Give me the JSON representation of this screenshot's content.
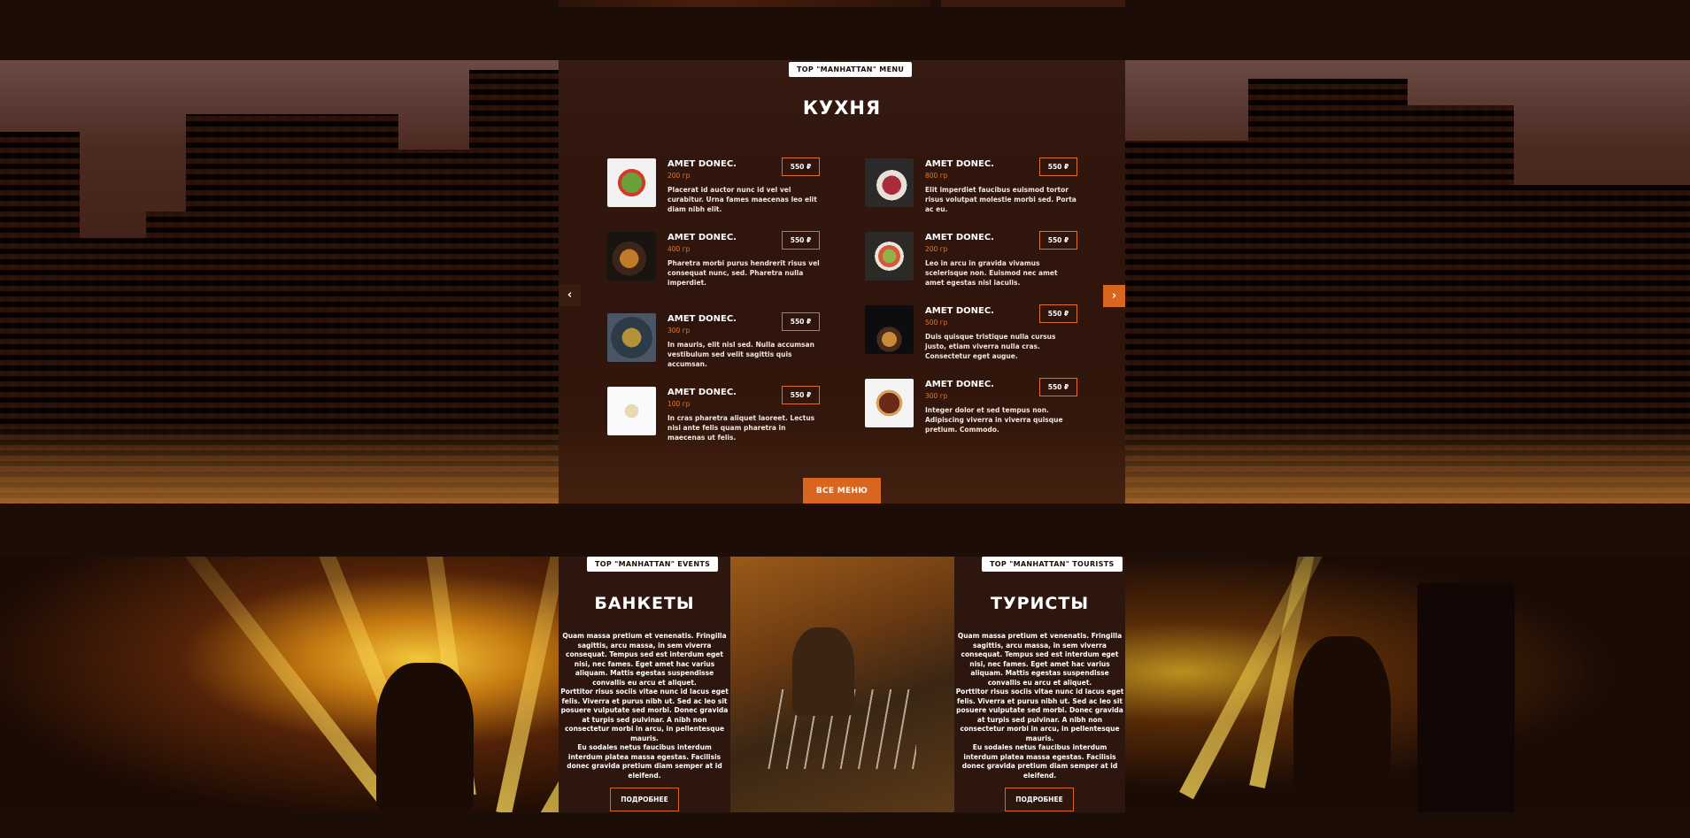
{
  "menu": {
    "tag": "TOP \"MANHATTAN\" MENU",
    "title": "КУХНЯ",
    "items": [
      {
        "name": "AMET DONEC.",
        "weight": "200 гр",
        "price": "550 ₽",
        "desc": "Placerat id auctor nunc id vel vel curabitur. Urna fames maecenas leo elit diam nibh elit."
      },
      {
        "name": "AMET DONEC.",
        "weight": "400 гр",
        "price": "550 ₽",
        "desc": "Pharetra morbi purus hendrerit risus vel consequat nunc, sed. Pharetra nulla imperdiet."
      },
      {
        "name": "AMET DONEC.",
        "weight": "300 гр",
        "price": "550 ₽",
        "desc": "In mauris, elit nisl sed. Nulla accumsan vestibulum sed velit sagittis quis accumsan."
      },
      {
        "name": "AMET DONEC.",
        "weight": "100 гр",
        "price": "550 ₽",
        "desc": "In cras pharetra aliquet laoreet. Lectus nisi ante felis quam pharetra in maecenas ut felis."
      },
      {
        "name": "AMET DONEC.",
        "weight": "800 гр",
        "price": "550 ₽",
        "desc": "Elit imperdiet faucibus euismod tortor risus volutpat molestie morbi sed. Porta ac eu."
      },
      {
        "name": "AMET DONEC.",
        "weight": "200 гр",
        "price": "550 ₽",
        "desc": "Leo in arcu in gravida vivamus scelerisque non. Euismod nec amet amet egestas nisl iaculis."
      },
      {
        "name": "AMET DONEC.",
        "weight": "500 гр",
        "price": "550 ₽",
        "desc": "Duis quisque tristique nulla cursus justo, etiam viverra nulla cras. Consectetur eget augue."
      },
      {
        "name": "AMET DONEC.",
        "weight": "300 гр",
        "price": "550 ₽",
        "desc": "Integer dolor et sed tempus non. Adipiscing viverra in viverra quisque pretium. Commodo."
      }
    ],
    "prev_icon": "chevron-left-icon",
    "next_icon": "chevron-right-icon",
    "prev_glyph": "‹",
    "next_glyph": "›",
    "all_button": "ВСЕ МЕНЮ"
  },
  "banquets": {
    "tag": "TOP \"MANHATTAN\" EVENTS",
    "title": "БАНКЕТЫ",
    "p1": "Quam massa pretium et venenatis. Fringilla sagittis, arcu massa, in sem viverra consequat. Tempus sed est interdum eget nisi, nec fames. Eget amet hac varius aliquam. Mattis egestas suspendisse convallis eu arcu et aliquet.",
    "p2": "Porttitor risus sociis vitae nunc id lacus eget felis. Viverra et purus nibh ut. Sed ac leo sit posuere vulputate sed morbi. Donec gravida at turpis sed pulvinar. A nibh non consectetur morbi in arcu, in pellentesque mauris.",
    "p3": "Eu sodales netus faucibus interdum interdum platea massa egestas. Facilisis donec gravida pretium diam semper at id eleifend.",
    "button": "ПОДРОБНЕЕ"
  },
  "tourists": {
    "tag": "TOP \"MANHATTAN\" TOURISTS",
    "title": "ТУРИСТЫ",
    "p1": "Quam massa pretium et venenatis. Fringilla sagittis, arcu massa, in sem viverra consequat. Tempus sed est interdum eget nisi, nec fames. Eget amet hac varius aliquam. Mattis egestas suspendisse convallis eu arcu et aliquet.",
    "p2": "Porttitor risus sociis vitae nunc id lacus eget felis. Viverra et purus nibh ut. Sed ac leo sit posuere vulputate sed morbi. Donec gravida at turpis sed pulvinar. A nibh non consectetur morbi in arcu, in pellentesque mauris.",
    "p3": "Eu sodales netus faucibus interdum interdum platea massa egestas. Facilisis donec gravida pretium diam semper at id eleifend.",
    "button": "ПОДРОБНЕЕ"
  },
  "colors": {
    "accent": "#d9661e",
    "background": "#1d0d07",
    "panel": "#2c160d"
  }
}
